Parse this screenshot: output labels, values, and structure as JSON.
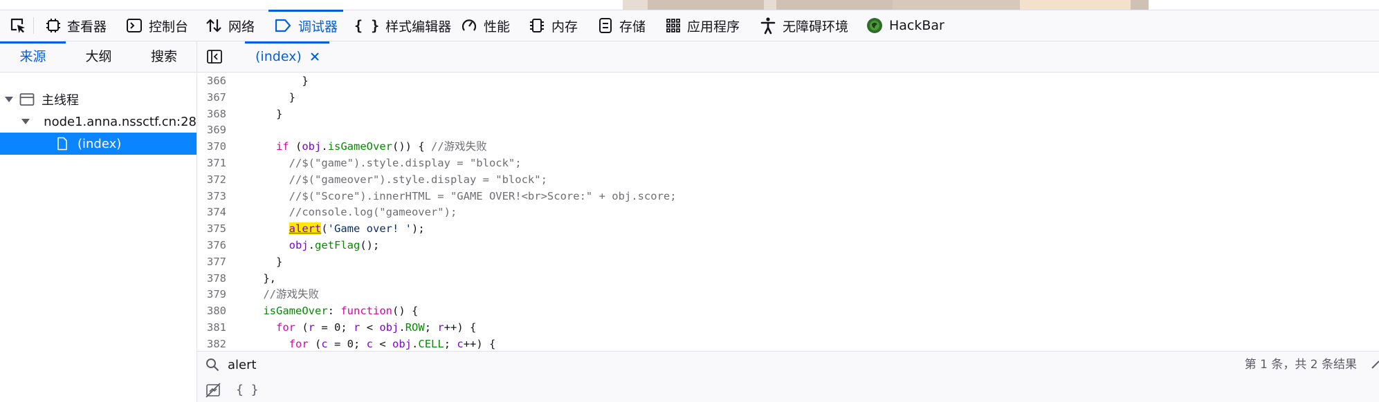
{
  "toolbar": {
    "tools": [
      {
        "label": "查看器",
        "icon": "inspector-icon"
      },
      {
        "label": "控制台",
        "icon": "console-icon"
      },
      {
        "label": "网络",
        "icon": "network-icon"
      },
      {
        "label": "调试器",
        "icon": "debugger-icon",
        "active": true
      },
      {
        "label": "样式编辑器",
        "icon": "style-editor-icon"
      },
      {
        "label": "性能",
        "icon": "performance-icon"
      },
      {
        "label": "内存",
        "icon": "memory-icon"
      },
      {
        "label": "存储",
        "icon": "storage-icon"
      },
      {
        "label": "应用程序",
        "icon": "application-icon"
      },
      {
        "label": "无障碍环境",
        "icon": "accessibility-icon"
      },
      {
        "label": "HackBar",
        "icon": "hackbar-icon"
      }
    ]
  },
  "sources_panel": {
    "tabs": [
      "来源",
      "大纲",
      "搜索"
    ],
    "active_tab": "来源",
    "tree": {
      "thread": "主线程",
      "host": "node1.anna.nssctf.cn:28",
      "file": "(index)"
    }
  },
  "editor": {
    "tab_label": "(index)",
    "lines": [
      {
        "n": "366",
        "indent": "          ",
        "tokens": [
          {
            "t": "}"
          }
        ]
      },
      {
        "n": "367",
        "indent": "        ",
        "tokens": [
          {
            "t": "}"
          }
        ]
      },
      {
        "n": "368",
        "indent": "      ",
        "tokens": [
          {
            "t": "}"
          }
        ]
      },
      {
        "n": "369",
        "indent": "",
        "tokens": []
      },
      {
        "n": "370",
        "indent": "      ",
        "tokens": [
          {
            "t": "if",
            "c": "kw"
          },
          {
            "t": " ("
          },
          {
            "t": "obj",
            "c": "ob"
          },
          {
            "t": "."
          },
          {
            "t": "isGameOver",
            "c": "pr"
          },
          {
            "t": "()) { "
          },
          {
            "t": "//游戏失败",
            "c": "cm"
          }
        ]
      },
      {
        "n": "371",
        "indent": "        ",
        "tokens": [
          {
            "t": "//$(\"game\").style.display = \"block\";",
            "c": "cm"
          }
        ]
      },
      {
        "n": "372",
        "indent": "        ",
        "tokens": [
          {
            "t": "//$(\"gameover\").style.display = \"block\";",
            "c": "cm"
          }
        ]
      },
      {
        "n": "373",
        "indent": "        ",
        "tokens": [
          {
            "t": "//$(\"Score\").innerHTML = \"GAME OVER!<br>Score:\" + obj.score;",
            "c": "cm"
          }
        ]
      },
      {
        "n": "374",
        "indent": "        ",
        "tokens": [
          {
            "t": "//console.log(\"gameover\");",
            "c": "cm"
          }
        ]
      },
      {
        "n": "375",
        "indent": "        ",
        "tokens": [
          {
            "t": "alert",
            "c": "hl"
          },
          {
            "t": "("
          },
          {
            "t": "'Game over! '",
            "c": "st"
          },
          {
            "t": ");"
          }
        ]
      },
      {
        "n": "376",
        "indent": "        ",
        "tokens": [
          {
            "t": "obj",
            "c": "ob"
          },
          {
            "t": "."
          },
          {
            "t": "getFlag",
            "c": "pr"
          },
          {
            "t": "();"
          }
        ]
      },
      {
        "n": "377",
        "indent": "      ",
        "tokens": [
          {
            "t": "}"
          }
        ]
      },
      {
        "n": "378",
        "indent": "    ",
        "tokens": [
          {
            "t": "},"
          }
        ]
      },
      {
        "n": "379",
        "indent": "    ",
        "tokens": [
          {
            "t": "//游戏失败",
            "c": "cm"
          }
        ]
      },
      {
        "n": "380",
        "indent": "    ",
        "tokens": [
          {
            "t": "isGameOver",
            "c": "pr"
          },
          {
            "t": ": "
          },
          {
            "t": "function",
            "c": "kw"
          },
          {
            "t": "() {"
          }
        ]
      },
      {
        "n": "381",
        "indent": "      ",
        "tokens": [
          {
            "t": "for",
            "c": "kw"
          },
          {
            "t": " ("
          },
          {
            "t": "r",
            "c": "ob"
          },
          {
            "t": " = 0; "
          },
          {
            "t": "r",
            "c": "ob"
          },
          {
            "t": " < "
          },
          {
            "t": "obj",
            "c": "ob"
          },
          {
            "t": "."
          },
          {
            "t": "ROW",
            "c": "pr"
          },
          {
            "t": "; "
          },
          {
            "t": "r",
            "c": "ob"
          },
          {
            "t": "++) {"
          }
        ]
      },
      {
        "n": "382",
        "indent": "        ",
        "tokens": [
          {
            "t": "for",
            "c": "kw"
          },
          {
            "t": " ("
          },
          {
            "t": "c",
            "c": "ob"
          },
          {
            "t": " = 0; "
          },
          {
            "t": "c",
            "c": "ob"
          },
          {
            "t": " < "
          },
          {
            "t": "obj",
            "c": "ob"
          },
          {
            "t": "."
          },
          {
            "t": "CELL",
            "c": "pr"
          },
          {
            "t": "; "
          },
          {
            "t": "c",
            "c": "ob"
          },
          {
            "t": "++) {"
          }
        ]
      }
    ]
  },
  "search": {
    "value": "alert",
    "result_count": "第 1 条，共 2 条结果"
  },
  "footer": {
    "pretty_print": "{ }"
  },
  "colors": {
    "accent": "#0060df",
    "selection": "#0a84ff",
    "keyword": "#dd00a9",
    "property": "#058b00",
    "object": "#8000d7",
    "comment": "#6e6e73",
    "highlight": "#ffe900"
  }
}
